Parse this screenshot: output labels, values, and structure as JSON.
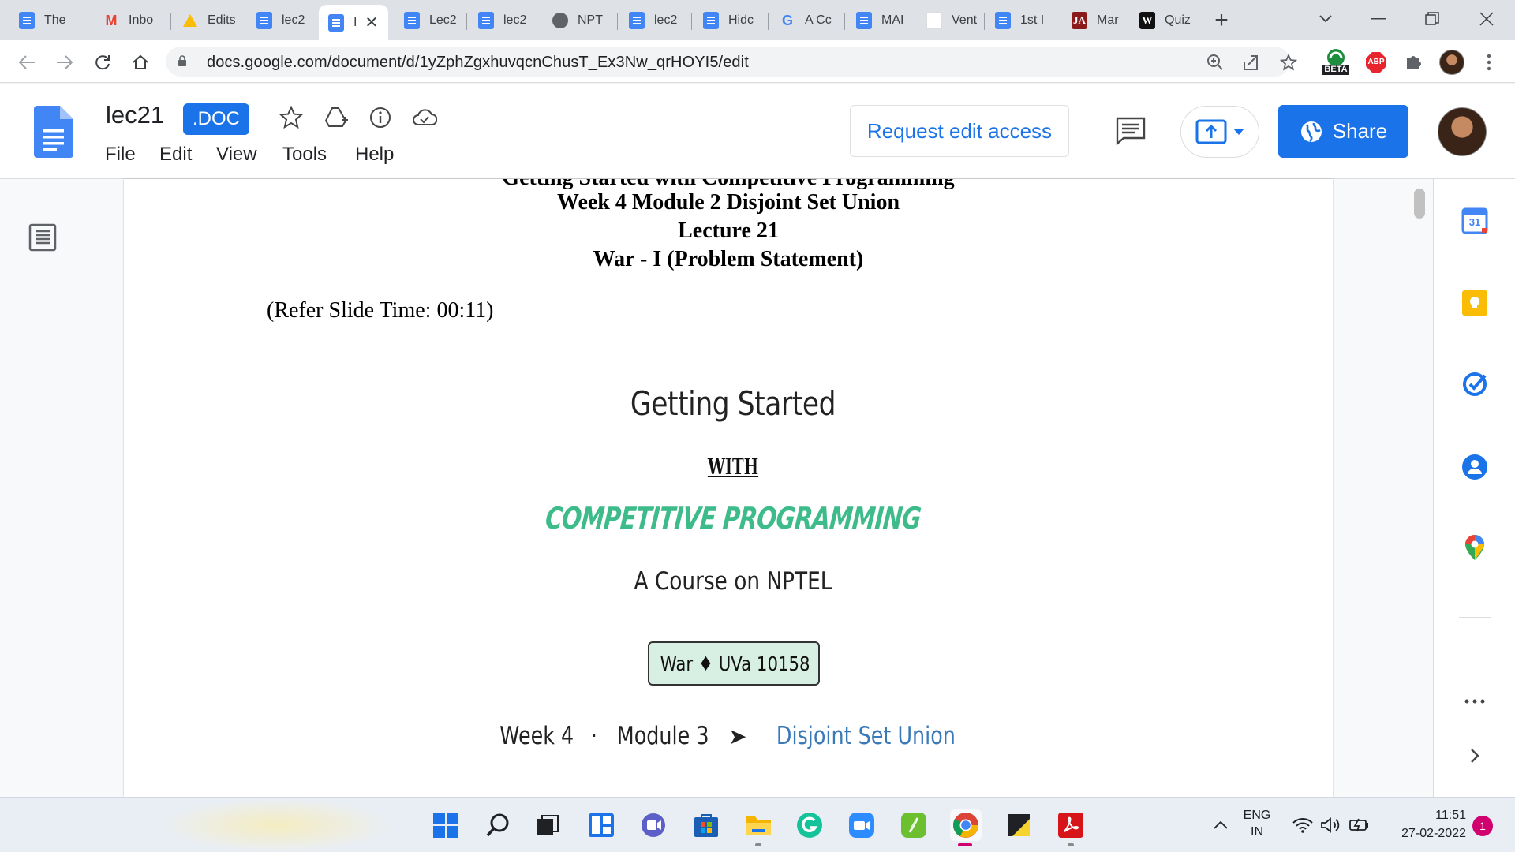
{
  "browser": {
    "tabs": [
      {
        "title": "The",
        "icon": "docs-icon"
      },
      {
        "title": "Inbo",
        "icon": "gmail-icon"
      },
      {
        "title": "Edits",
        "icon": "drive-icon"
      },
      {
        "title": "lec2",
        "icon": "docs-icon"
      },
      {
        "title": "I",
        "icon": "docs-icon",
        "active": true
      },
      {
        "title": "Lec2",
        "icon": "docs-icon"
      },
      {
        "title": "lec2",
        "icon": "docs-icon"
      },
      {
        "title": "NPT",
        "icon": "globe-icon"
      },
      {
        "title": "lec2",
        "icon": "docs-icon"
      },
      {
        "title": "Hidc",
        "icon": "docs-icon"
      },
      {
        "title": "A Cc",
        "icon": "google-icon"
      },
      {
        "title": "MAI",
        "icon": "docs-icon"
      },
      {
        "title": "Vent",
        "icon": "blank-icon"
      },
      {
        "title": "1st I",
        "icon": "docs-icon"
      },
      {
        "title": "Mar",
        "icon": "ja-icon"
      },
      {
        "title": "Quiz",
        "icon": "w-icon"
      }
    ],
    "favicon_text": {
      "gmail": "M",
      "google": "G",
      "ja": "JA",
      "w": "W"
    },
    "url": "docs.google.com/document/d/1yZphZgxhuvqcnChusT_Ex3Nw_qrHOYI5/edit",
    "ext_beta_label": "BETA",
    "ext_abp_label": "ABP"
  },
  "docs": {
    "title": "lec21",
    "badge": ".DOC",
    "menu": [
      "File",
      "Edit",
      "View",
      "Tools",
      "Help"
    ],
    "request_edit_label": "Request edit access",
    "share_label": "Share"
  },
  "document": {
    "cut_line": "Getting Started with Competitive Programming",
    "line1": "Week 4 Module 2 Disjoint Set Union",
    "line2": "Lecture 21",
    "line3": "War - I (Problem Statement)",
    "refer": "(Refer Slide Time: 00:11)"
  },
  "slide": {
    "title": "Getting Started",
    "with": "WITH",
    "subtitle": "COMPETITIVE PROGRAMMING",
    "course": "A Course on NPTEL",
    "badge": "War ♦ UVa 10158",
    "path_week": "Week 4",
    "path_sep": "·",
    "path_module": "Module 3",
    "path_arrow": "➤",
    "path_topic": "Disjoint Set Union"
  },
  "side_panel": {
    "calendar_day": "31"
  },
  "taskbar": {
    "lang_top": "ENG",
    "lang_bottom": "IN",
    "time": "11:51",
    "date": "27-02-2022",
    "notification_count": "1"
  },
  "colors": {
    "accent": "#1a73e8",
    "slide_green": "#3dbb8a",
    "slide_blue": "#3a79b8",
    "badge_bg": "#d8efe3"
  }
}
